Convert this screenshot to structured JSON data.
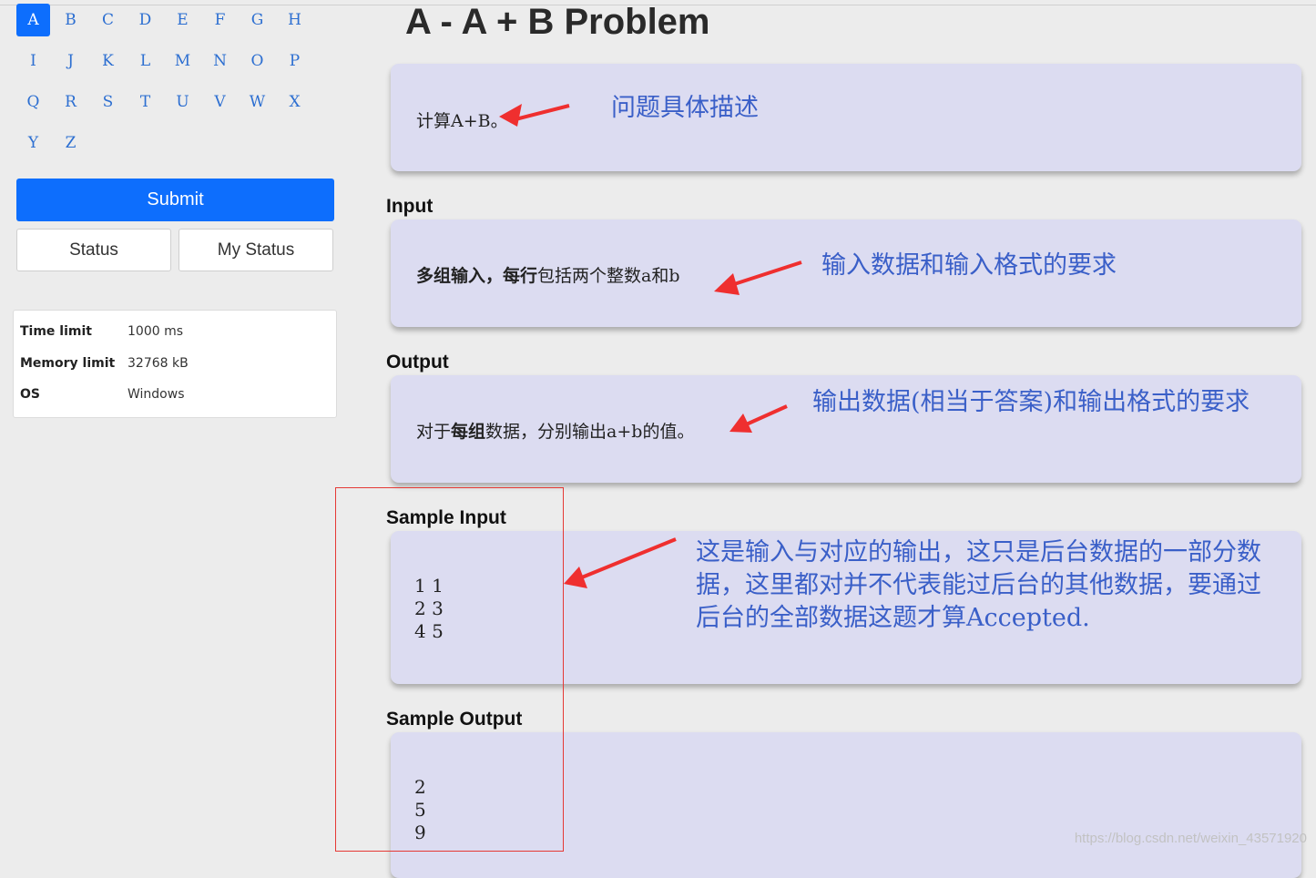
{
  "letters": [
    "A",
    "B",
    "C",
    "D",
    "E",
    "F",
    "G",
    "H",
    "I",
    "J",
    "K",
    "L",
    "M",
    "N",
    "O",
    "P",
    "Q",
    "R",
    "S",
    "T",
    "U",
    "V",
    "W",
    "X",
    "Y",
    "Z"
  ],
  "active_letter": "A",
  "buttons": {
    "submit": "Submit",
    "status": "Status",
    "my_status": "My Status"
  },
  "limits": [
    {
      "key": "Time limit",
      "value": "1000 ms"
    },
    {
      "key": "Memory limit",
      "value": "32768 kB"
    },
    {
      "key": "OS",
      "value": "Windows"
    }
  ],
  "problem": {
    "title": "A - A + B Problem",
    "description": "计算A+B。",
    "input_label": "Input",
    "input_bold_1": "多组输入，",
    "input_bold_2": "每行",
    "input_rest": "包括两个整数a和b",
    "output_label": "Output",
    "output_pre": "对于",
    "output_bold": "每组",
    "output_rest": "数据，分别输出a+b的值。",
    "sample_input_label": "Sample Input",
    "sample_input": "1 1\n2 3\n4 5",
    "sample_output_label": "Sample Output",
    "sample_output": "2\n5\n9"
  },
  "annotations": {
    "desc": "问题具体描述",
    "input": "输入数据和输入格式的要求",
    "output": "输出数据(相当于答案)和输出格式的要求",
    "sample_1": "这是输入与对应的输出，这只是后台数据的一部分数",
    "sample_2": "据，这里都对并不代表能过后台的其他数据，要通过",
    "sample_3": "后台的全部数据这题才算Accepted."
  },
  "colors": {
    "accent": "#0d6efd",
    "card": "#dcdcf1",
    "annotation": "#3a5fc8",
    "arrow": "#ef2f2f"
  },
  "watermark": "https://blog.csdn.net/weixin_43571920"
}
